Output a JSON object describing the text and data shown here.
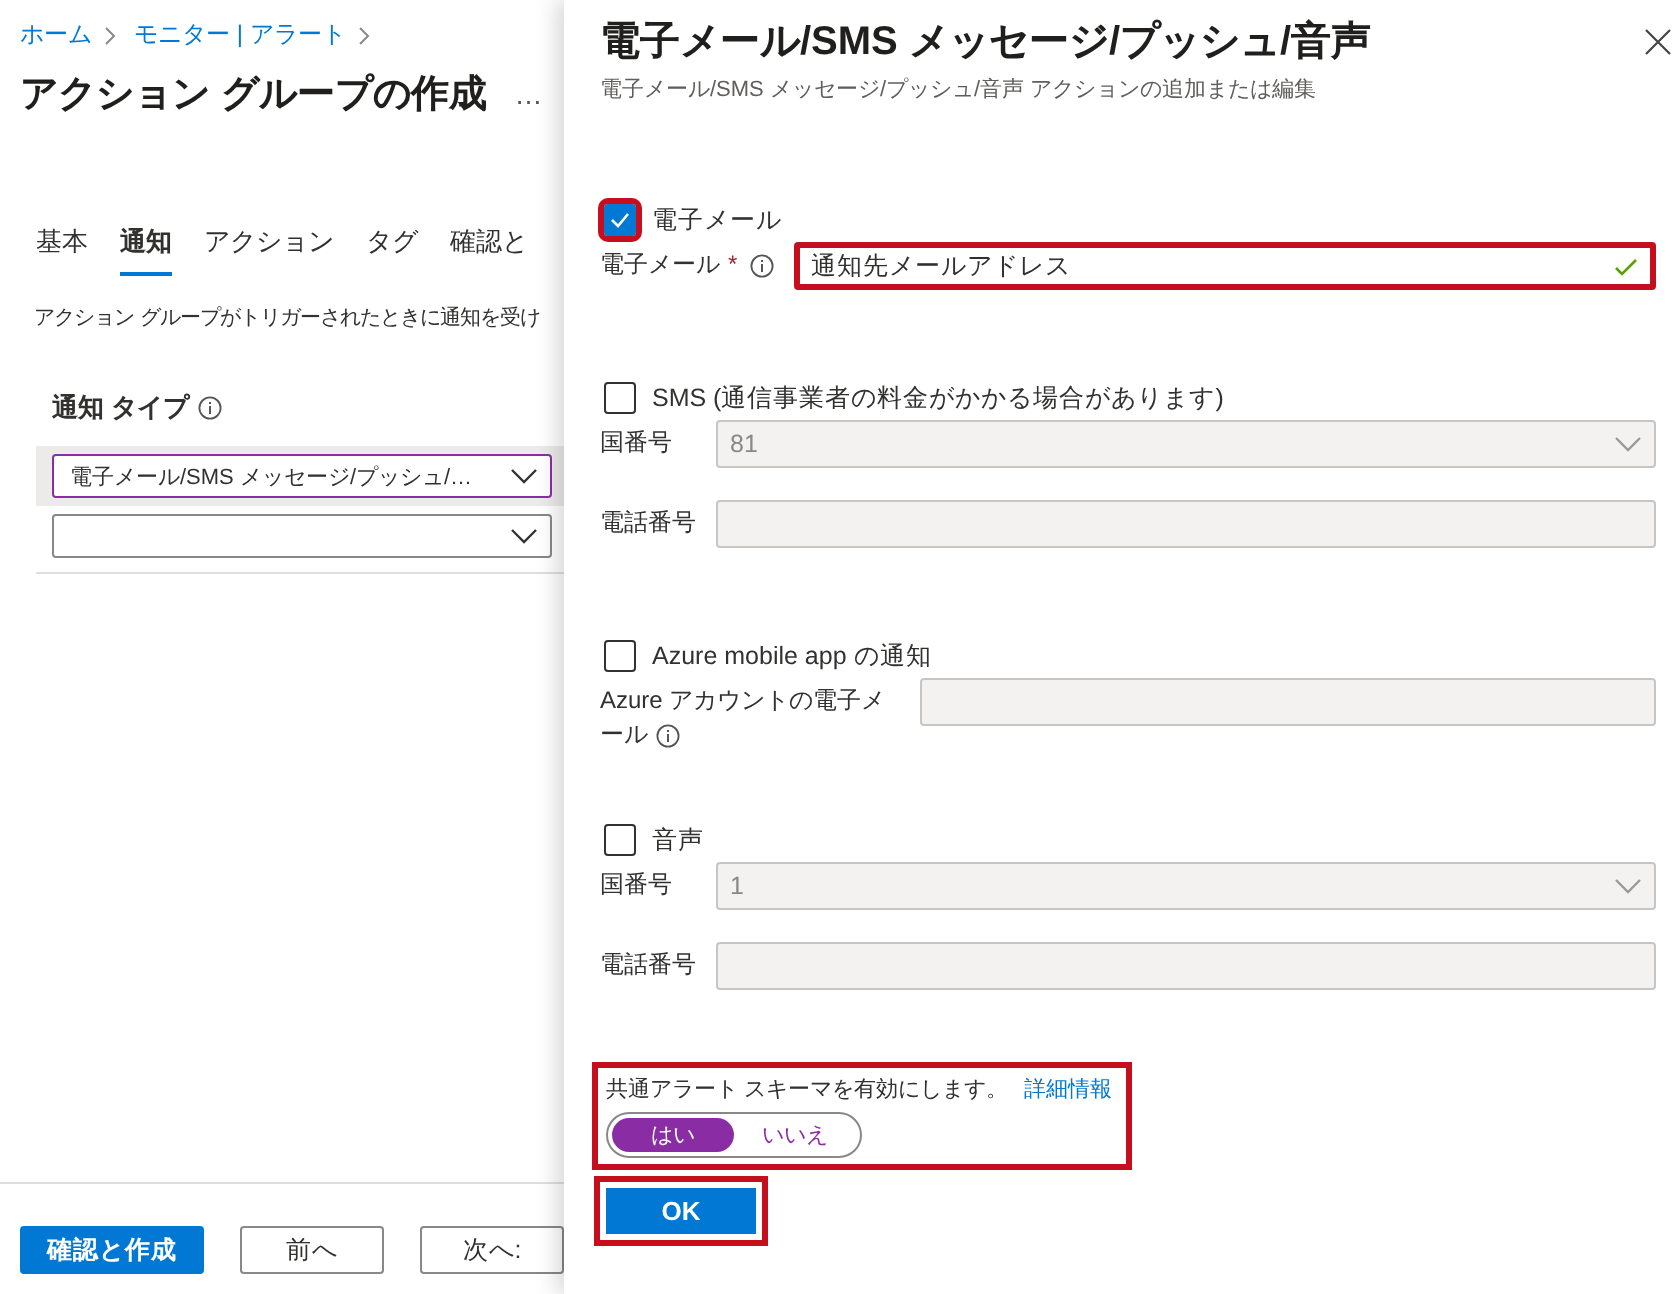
{
  "breadcrumb": [
    {
      "label": "ホーム"
    },
    {
      "label": "モニター | アラート"
    }
  ],
  "page_title": "アクション グループの作成",
  "more_button": "…",
  "tabs": [
    {
      "label": "基本",
      "selected": false
    },
    {
      "label": "通知",
      "selected": true
    },
    {
      "label": "アクション",
      "selected": false
    },
    {
      "label": "タグ",
      "selected": false
    },
    {
      "label": "確認と",
      "selected": false
    }
  ],
  "description": "アクション グループがトリガーされたときに通知を受け",
  "notification_type": {
    "label": "通知 タイプ",
    "info": true
  },
  "notification_rows": [
    {
      "value": "電子メール/SMS メッセージ/プッシュ/…",
      "selected": true
    },
    {
      "selected": false
    }
  ],
  "footer_buttons": [
    {
      "label": "確認と作成",
      "kind": "primary"
    },
    {
      "label": "前へ",
      "kind": "secondary"
    },
    {
      "label": "次へ:",
      "kind": "secondary"
    }
  ],
  "panel": {
    "title": "電子メール/SMS メッセージ/プッシュ/音声",
    "subtitle": "電子メール/SMS メッセージ/プッシュ/音声 アクションの追加または編集",
    "sections": [
      {
        "checkbox_label": "電子メール",
        "checked": true,
        "highlighted": true,
        "fields": [
          {
            "label": "電子メール",
            "required_mark": "*",
            "info": true,
            "kind": "text",
            "value": "通知先メールアドレス",
            "valid": true,
            "disabled": false,
            "highlighted": true
          }
        ]
      },
      {
        "checkbox_label": "SMS (通信事業者の料金がかかる場合があります)",
        "checked": false,
        "highlighted": false,
        "fields": [
          {
            "label": "国番号",
            "kind": "dropdown",
            "value": "81",
            "disabled": true,
            "highlighted": false
          },
          {
            "label": "電話番号",
            "kind": "text",
            "disabled": true,
            "highlighted": false
          }
        ]
      },
      {
        "checkbox_label": "Azure mobile app の通知",
        "checked": false,
        "highlighted": false,
        "fields": [
          {
            "label": "Azure アカウントの電子メール",
            "info": true,
            "kind": "text",
            "disabled": true,
            "highlighted": false
          }
        ]
      },
      {
        "checkbox_label": "音声",
        "checked": false,
        "highlighted": false,
        "fields": [
          {
            "label": "国番号",
            "kind": "dropdown",
            "value": "1",
            "disabled": true,
            "highlighted": false
          },
          {
            "label": "電話番号",
            "kind": "text",
            "disabled": true,
            "highlighted": false
          }
        ]
      }
    ],
    "schema": {
      "label": "共通アラート スキーマを有効にします。",
      "link": "詳細情報",
      "highlighted": true,
      "options": [
        {
          "label": "はい",
          "selected": true
        },
        {
          "label": "いいえ",
          "selected": false
        }
      ]
    },
    "ok_button": {
      "label": "OK",
      "highlighted": true
    }
  }
}
